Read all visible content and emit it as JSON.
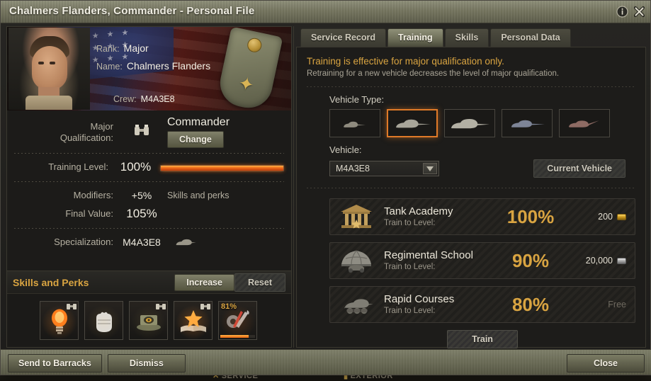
{
  "window": {
    "title": "Chalmers Flanders, Commander - Personal File",
    "controls": [
      {
        "name": "info-icon",
        "glyph": "i"
      },
      {
        "name": "close-icon",
        "glyph": "x"
      }
    ]
  },
  "background": {
    "tabs": [
      {
        "label": "SERVICE"
      },
      {
        "label": "EXTERIOR"
      }
    ]
  },
  "crew": {
    "rank_label": "Rank:",
    "rank_value": "Major",
    "name_label": "Name:",
    "name_value": "Chalmers Flanders",
    "crew_label": "Crew:",
    "crew_value": "M4A3E8",
    "portrait_alt": "commander-portrait",
    "flag": "usa"
  },
  "stats": {
    "qualification_label_line1": "Major",
    "qualification_label_line2": "Qualification:",
    "qualification_icon": "binoculars-icon",
    "role": "Commander",
    "change_button": "Change",
    "training_level_label": "Training Level:",
    "training_level_value": "100%",
    "training_level_percent": 100,
    "modifiers_label": "Modifiers:",
    "modifiers_value": "+5%",
    "modifiers_note": "Skills and perks",
    "final_value_label": "Final Value:",
    "final_value_value": "105%",
    "specialization_label": "Specialization:",
    "specialization_value": "M4A3E8",
    "specialization_icon": "medium-tank-icon"
  },
  "skills_panel": {
    "title": "Skills and Perks",
    "increase_button": "Increase",
    "reset_button": "Reset",
    "skills": [
      {
        "name": "sixth-sense-skill",
        "icon": "lightbulb-icon",
        "role_tag": "binoculars-icon",
        "progress": null,
        "percent_label": ""
      },
      {
        "name": "brothers-in-arms-skill",
        "icon": "fist-icon",
        "role_tag": "",
        "progress": null,
        "percent_label": ""
      },
      {
        "name": "recon-skill",
        "icon": "commanders-hatch-icon",
        "role_tag": "binoculars-icon",
        "progress": null,
        "percent_label": ""
      },
      {
        "name": "eagle-eye-skill",
        "icon": "star-book-icon",
        "role_tag": "binoculars-icon",
        "progress": null,
        "percent_label": ""
      },
      {
        "name": "repairs-skill",
        "icon": "wrench-gear-icon",
        "role_tag": "",
        "progress": 81,
        "percent_label": "81%"
      }
    ]
  },
  "tabs": [
    {
      "label": "Service Record",
      "active": false
    },
    {
      "label": "Training",
      "active": true
    },
    {
      "label": "Skills",
      "active": false
    },
    {
      "label": "Personal Data",
      "active": false
    }
  ],
  "training": {
    "notice_main": "Training is effective for major qualification only.",
    "notice_sub": "Retraining for a new vehicle decreases the level of major qualification.",
    "vehicle_type_label": "Vehicle Type:",
    "vehicle_types": [
      {
        "name": "light-tank-type",
        "icon": "light-tank-icon",
        "selected": false
      },
      {
        "name": "medium-tank-type",
        "icon": "medium-tank-icon",
        "selected": true
      },
      {
        "name": "heavy-tank-type",
        "icon": "heavy-tank-icon",
        "selected": false
      },
      {
        "name": "tank-destroyer-type",
        "icon": "tank-destroyer-icon",
        "selected": false
      },
      {
        "name": "spg-type",
        "icon": "spg-icon",
        "selected": false
      }
    ],
    "vehicle_label": "Vehicle:",
    "vehicle_selected": "M4A3E8",
    "current_vehicle_button": "Current Vehicle",
    "options": [
      {
        "name": "Tank Academy",
        "sub": "Train to Level:",
        "level": "100%",
        "cost": "200",
        "currency": "gold",
        "icon": "academy-building-icon"
      },
      {
        "name": "Regimental School",
        "sub": "Train to Level:",
        "level": "90%",
        "cost": "20,000",
        "currency": "credits",
        "icon": "regimental-tent-icon"
      },
      {
        "name": "Rapid Courses",
        "sub": "Train to Level:",
        "level": "80%",
        "cost": "Free",
        "currency": "free",
        "icon": "rapid-tank-icon"
      }
    ],
    "train_button": "Train"
  },
  "footer": {
    "send_to_barracks": "Send to Barracks",
    "dismiss": "Dismiss",
    "close": "Close"
  },
  "colors": {
    "accent_gold": "#d9a441",
    "accent_orange": "#e07a28",
    "panel_bg": "#1d1c1a",
    "titlebar": "#75755f"
  }
}
